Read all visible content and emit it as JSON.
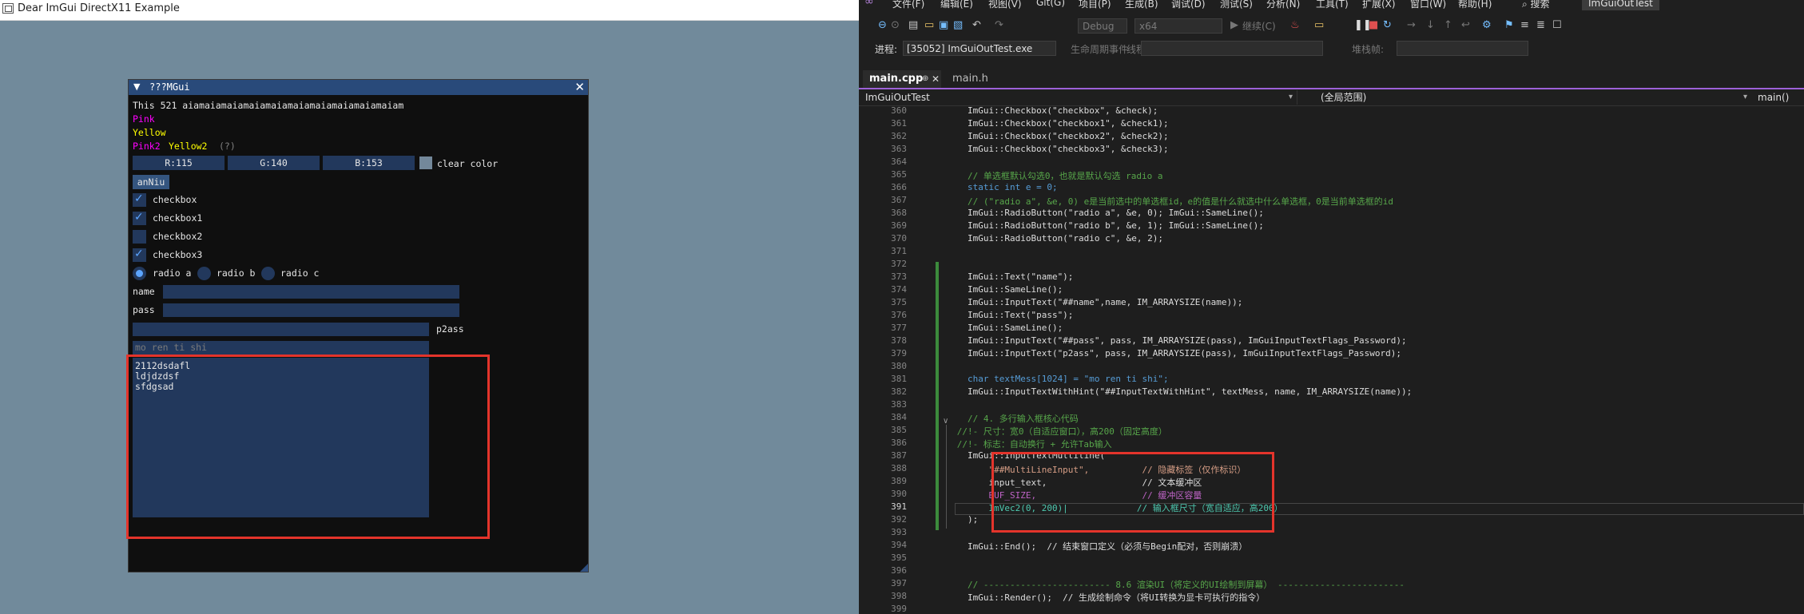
{
  "left_app": {
    "window_title": "Dear ImGui DirectX11 Example",
    "imgui": {
      "title": "???MGui",
      "collapse_glyph": "▼",
      "close_glyph": "✕",
      "line_text": "This 521 aiamaiamaiamaiamaiamaiamaiamaiamaiamaiam",
      "pink": "Pink",
      "yellow": "Yellow",
      "pink2": "Pink2",
      "yellow2": "Yellow2",
      "help": "(?)",
      "color_r": "R:115",
      "color_g": "G:140",
      "color_b": "B:153",
      "clear_color": "clear color",
      "button": "anNiu",
      "checkboxes": [
        {
          "label": "checkbox",
          "checked": true
        },
        {
          "label": "checkbox1",
          "checked": true
        },
        {
          "label": "checkbox2",
          "checked": false
        },
        {
          "label": "checkbox3",
          "checked": true
        }
      ],
      "radios": [
        {
          "label": "radio a",
          "selected": true
        },
        {
          "label": "radio b",
          "selected": false
        },
        {
          "label": "radio c",
          "selected": false
        }
      ],
      "name_label": "name",
      "pass_label": "pass",
      "p2ass_label": "p2ass",
      "hint": "mo ren ti shi",
      "multiline_lines": [
        "2112dsdafl",
        "ldjdzdsf",
        "sfdgsad"
      ],
      "colors": {
        "pink": "#ff00ff",
        "yellow": "#ffff00",
        "frame": "#22385c",
        "title": "#294a7a",
        "check": "#5ca5ff"
      }
    }
  },
  "vs": {
    "menu": [
      "文件(F)",
      "编辑(E)",
      "视图(V)",
      "Git(G)",
      "项目(P)",
      "生成(B)",
      "调试(D)",
      "测试(S)",
      "分析(N)",
      "工具(T)",
      "扩展(X)",
      "窗口(W)",
      "帮助(H)"
    ],
    "search": "搜索",
    "project_name": "ImGuiOutTest",
    "toolbar": {
      "config": "Debug",
      "platform": "x64",
      "continue": "继续(C)"
    },
    "procbar": {
      "process_label": "进程:",
      "process_value": "[35052] ImGuiOutTest.exe",
      "lifecycle": "生命周期事件",
      "thread_label": "线程:",
      "stack_label": "堆栈帧:"
    },
    "tabs": [
      {
        "label": "main.cpp",
        "active": true
      },
      {
        "label": "main.h",
        "active": false
      }
    ],
    "nav": {
      "project": "ImGuiOutTest",
      "scope": "(全局范围)",
      "function": "main()"
    },
    "code_lines": [
      {
        "n": "360",
        "t": "        ImGui::Checkbox(\"checkbox\", &check);"
      },
      {
        "n": "361",
        "t": "        ImGui::Checkbox(\"checkbox1\", &check1);"
      },
      {
        "n": "362",
        "t": "        ImGui::Checkbox(\"checkbox2\", &check2);"
      },
      {
        "n": "363",
        "t": "        ImGui::Checkbox(\"checkbox3\", &check3);"
      },
      {
        "n": "364",
        "t": ""
      },
      {
        "n": "365",
        "t": "        // 单选框默认勾选0，也就是默认勾选 radio a"
      },
      {
        "n": "366",
        "t": "        static int e = 0;"
      },
      {
        "n": "367",
        "t": "        // (\"radio a\", &e, 0) e是当前选中的单选框id，e的值是什么就选中什么单选框，0是当前单选框的id"
      },
      {
        "n": "368",
        "t": "        ImGui::RadioButton(\"radio a\", &e, 0); ImGui::SameLine();"
      },
      {
        "n": "369",
        "t": "        ImGui::RadioButton(\"radio b\", &e, 1); ImGui::SameLine();"
      },
      {
        "n": "370",
        "t": "        ImGui::RadioButton(\"radio c\", &e, 2);"
      },
      {
        "n": "371",
        "t": ""
      },
      {
        "n": "372",
        "t": ""
      },
      {
        "n": "373",
        "t": "        ImGui::Text(\"name\");"
      },
      {
        "n": "374",
        "t": "        ImGui::SameLine();"
      },
      {
        "n": "375",
        "t": "        ImGui::InputText(\"##name\",name, IM_ARRAYSIZE(name));"
      },
      {
        "n": "376",
        "t": "        ImGui::Text(\"pass\");"
      },
      {
        "n": "377",
        "t": "        ImGui::SameLine();"
      },
      {
        "n": "378",
        "t": "        ImGui::InputText(\"##pass\", pass, IM_ARRAYSIZE(pass), ImGuiInputTextFlags_Password);"
      },
      {
        "n": "379",
        "t": "        ImGui::InputText(\"p2ass\", pass, IM_ARRAYSIZE(pass), ImGuiInputTextFlags_Password);"
      },
      {
        "n": "380",
        "t": ""
      },
      {
        "n": "381",
        "t": "        char textMess[1024] = \"mo ren ti shi\";"
      },
      {
        "n": "382",
        "t": "        ImGui::InputTextWithHint(\"##InputTextWithHint\", textMess, name, IM_ARRAYSIZE(name));"
      },
      {
        "n": "383",
        "t": ""
      },
      {
        "n": "384",
        "t": "        // 4. 多行输入框核心代码"
      },
      {
        "n": "385",
        "t": "      //!- 尺寸：宽0（自适应窗口），高200（固定高度）"
      },
      {
        "n": "386",
        "t": "      //!- 标志：自动换行 + 允许Tab输入"
      },
      {
        "n": "387",
        "t": "        ImGui::InputTextMultiline("
      },
      {
        "n": "388",
        "t": "            \"##MultiLineInput\",          // 隐藏标签（仅作标识）"
      },
      {
        "n": "389",
        "t": "            input_text,                  // 文本缓冲区"
      },
      {
        "n": "390",
        "t": "            BUF_SIZE,                    // 缓冲区容量"
      },
      {
        "n": "391",
        "t": "            ImVec2(0, 200)|             // 输入框尺寸（宽自适应，高200）"
      },
      {
        "n": "392",
        "t": "        );"
      },
      {
        "n": "393",
        "t": ""
      },
      {
        "n": "394",
        "t": "        ImGui::End();  // 结束窗口定义（必须与Begin配对，否则崩溃）"
      },
      {
        "n": "395",
        "t": ""
      },
      {
        "n": "396",
        "t": ""
      },
      {
        "n": "397",
        "t": "        // ------------------------ 8.6 渲染UI（将定义的UI绘制到屏幕） ------------------------"
      },
      {
        "n": "398",
        "t": "        ImGui::Render();  // 生成绘制命令（将UI转换为显卡可执行的指令）"
      },
      {
        "n": "399",
        "t": ""
      }
    ],
    "current_line": "391",
    "syntax_colors": {
      "comment": "#57a64a",
      "keyword": "#569cd6",
      "string": "#d69d85",
      "type": "#4ec9b0",
      "func": "#dcdcaa",
      "macro": "#bd63c5",
      "default": "#dcdcdc"
    }
  }
}
